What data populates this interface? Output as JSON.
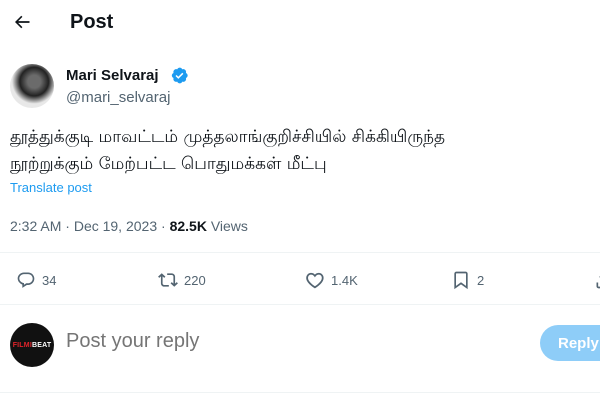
{
  "header": {
    "title": "Post",
    "back_icon": "arrow-left-icon"
  },
  "post": {
    "author_name": "Mari Selvaraj",
    "author_handle": "@mari_selvaraj",
    "verified": true,
    "text_line1": "தூத்துக்குடி மாவட்டம் முத்தலாங்குறிச்சியில் சிக்கியிருந்த",
    "text_line2": "நூற்றுக்கும் மேற்பட்ட பொதுமக்கள் மீட்பு",
    "translate_label": "Translate post",
    "time": "2:32 AM",
    "date": "Dec 19, 2023",
    "views_count": "82.5K",
    "views_label": "Views"
  },
  "actions": {
    "replies": "34",
    "reposts": "220",
    "likes": "1.4K",
    "bookmarks": "2"
  },
  "reply_box": {
    "placeholder": "Post your reply",
    "button_label": "Reply",
    "avatar_text_1": "FILMI",
    "avatar_text_2": "BEAT"
  },
  "colors": {
    "accent": "#1d9bf0",
    "reply_button_disabled": "#8ecdf8",
    "secondary_text": "#536471",
    "divider": "#eff3f4"
  }
}
